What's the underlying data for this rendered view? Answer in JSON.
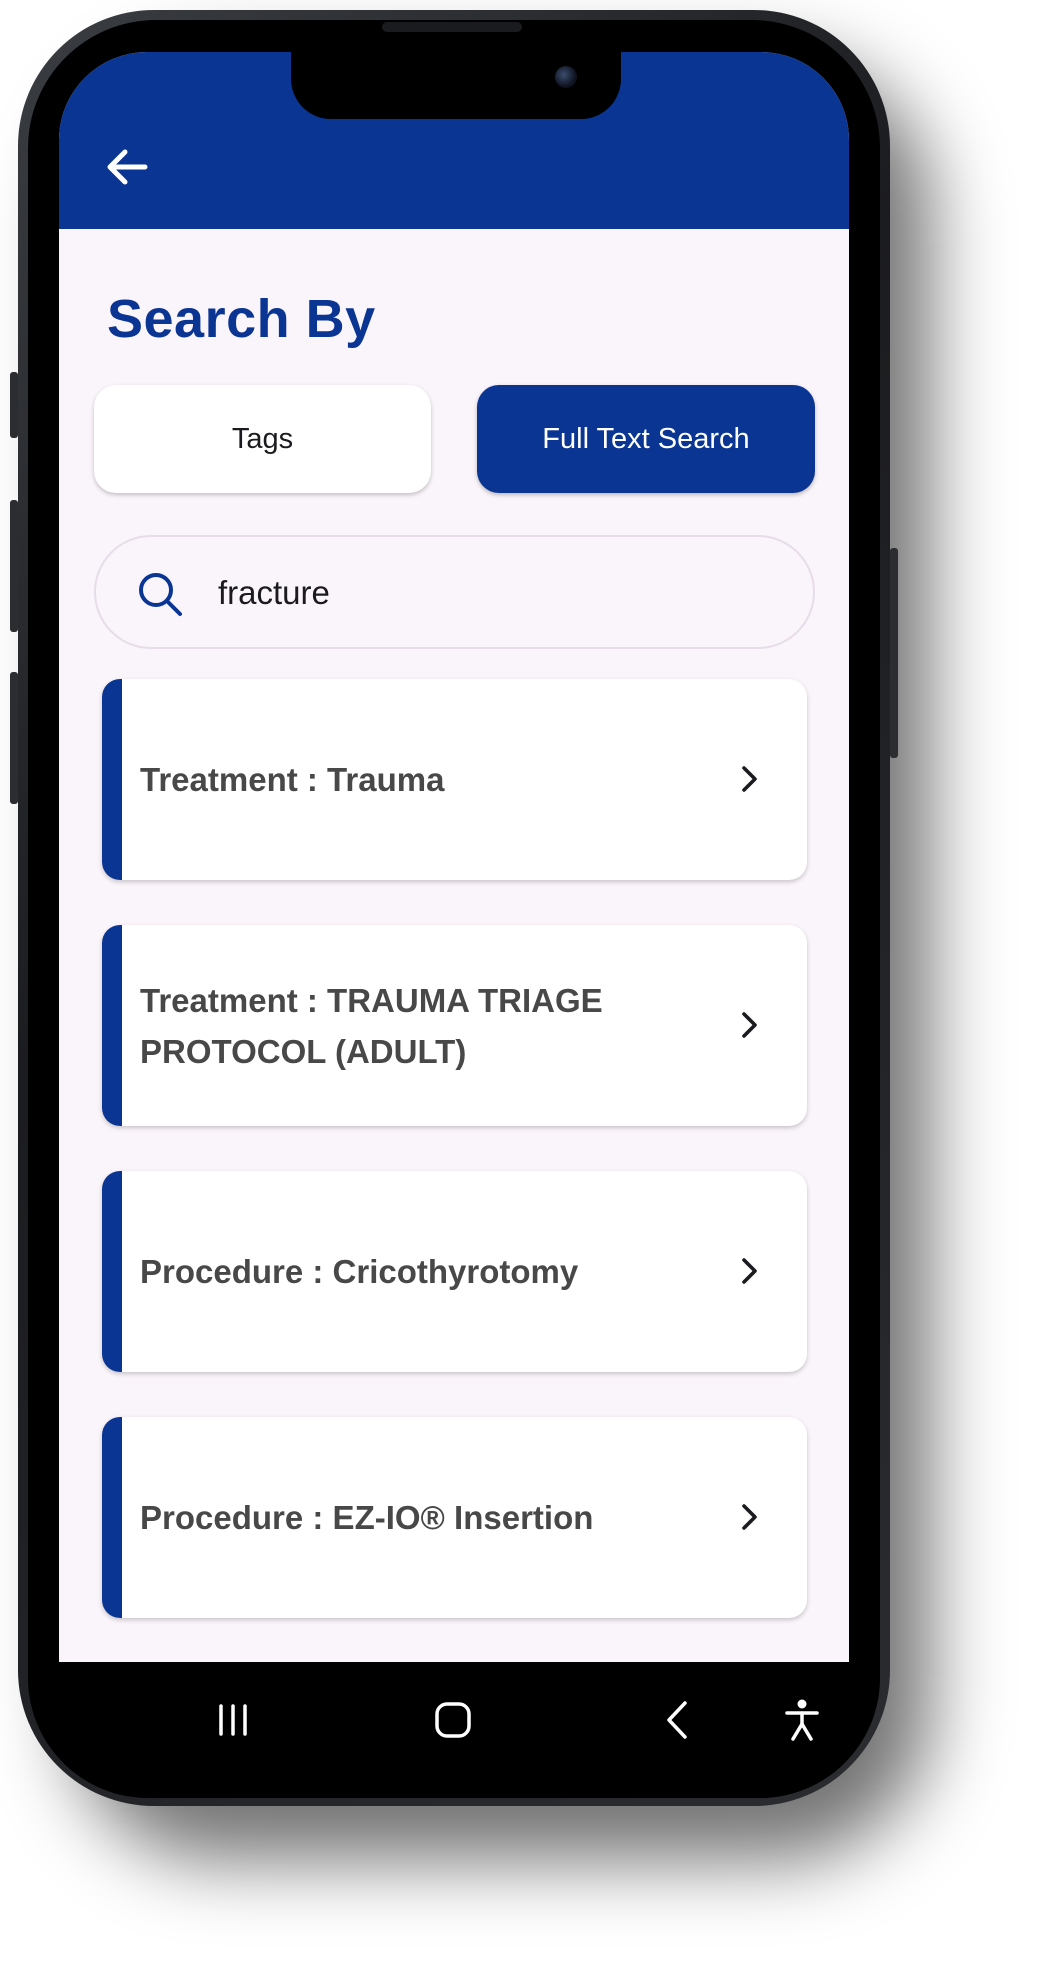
{
  "header": {
    "back_icon": "arrow-left-icon"
  },
  "page": {
    "title": "Search By"
  },
  "search_mode": {
    "options": [
      {
        "label": "Tags",
        "selected": false
      },
      {
        "label": "Full Text Search",
        "selected": true
      }
    ]
  },
  "search": {
    "icon": "search-icon",
    "value": "fracture"
  },
  "results": [
    {
      "label": "Treatment : Trauma"
    },
    {
      "label": "Treatment : TRAUMA TRIAGE PROTOCOL (ADULT)"
    },
    {
      "label": "Procedure : Cricothyrotomy"
    },
    {
      "label": "Procedure : EZ-IO® Insertion"
    }
  ],
  "nav_bar": {
    "buttons": [
      "recents-icon",
      "home-icon",
      "back-icon",
      "accessibility-icon"
    ]
  },
  "colors": {
    "primary": "#0a3592",
    "background": "#faf4fb",
    "card_text": "#484848"
  }
}
